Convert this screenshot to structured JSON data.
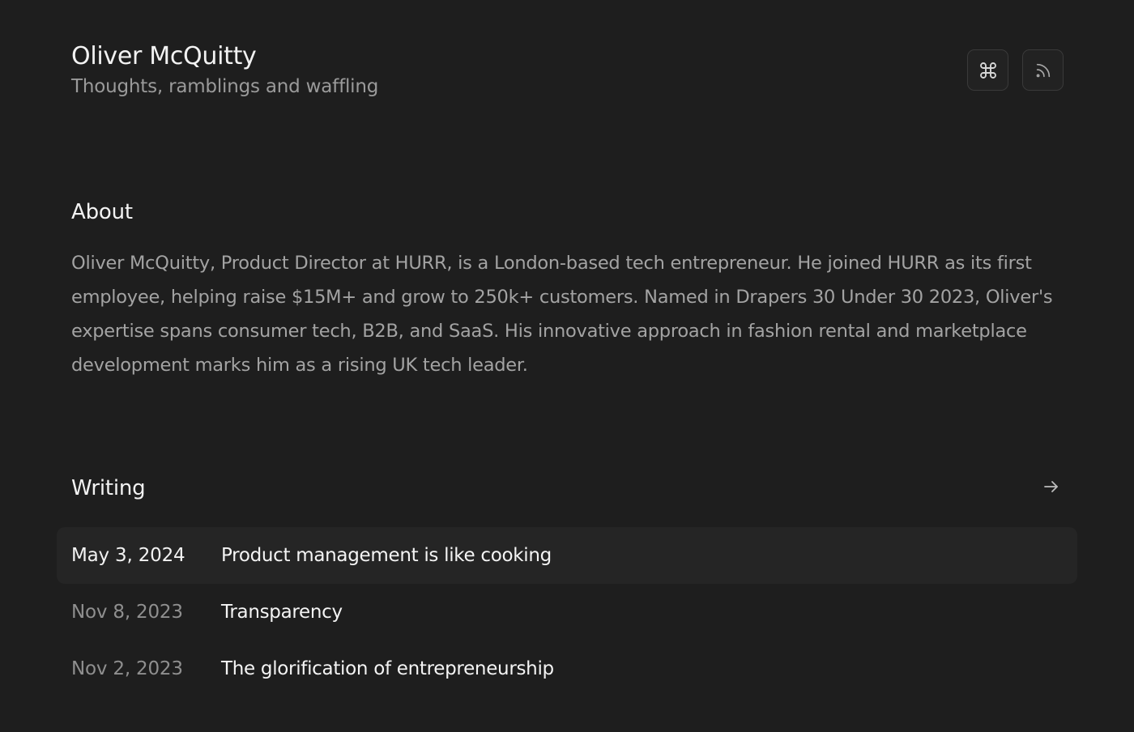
{
  "header": {
    "title": "Oliver McQuitty",
    "tagline": "Thoughts, ramblings and waffling",
    "actions": [
      {
        "icon": "command-icon"
      },
      {
        "icon": "rss-icon"
      }
    ]
  },
  "about": {
    "heading": "About",
    "text": "Oliver McQuitty, Product Director at HURR, is a London-based tech entrepreneur. He joined HURR as its first employee, helping raise $15M+ and grow to 250k+ customers. Named in Drapers 30 Under 30 2023, Oliver's expertise spans consumer tech, B2B, and SaaS. His innovative approach in fashion rental and marketplace development marks him as a rising UK tech leader."
  },
  "writing": {
    "heading": "Writing",
    "arrow_icon": "arrow-right-icon",
    "posts": [
      {
        "date": "May 3, 2024",
        "title": "Product management is like cooking"
      },
      {
        "date": "Nov 8, 2023",
        "title": "Transparency"
      },
      {
        "date": "Nov 2, 2023",
        "title": "The glorification of entrepreneurship"
      }
    ]
  },
  "colors": {
    "background": "#1e1e1e",
    "text_primary": "#f2f2f2",
    "text_secondary": "#a3a3a3",
    "highlight_row": "#252525"
  }
}
